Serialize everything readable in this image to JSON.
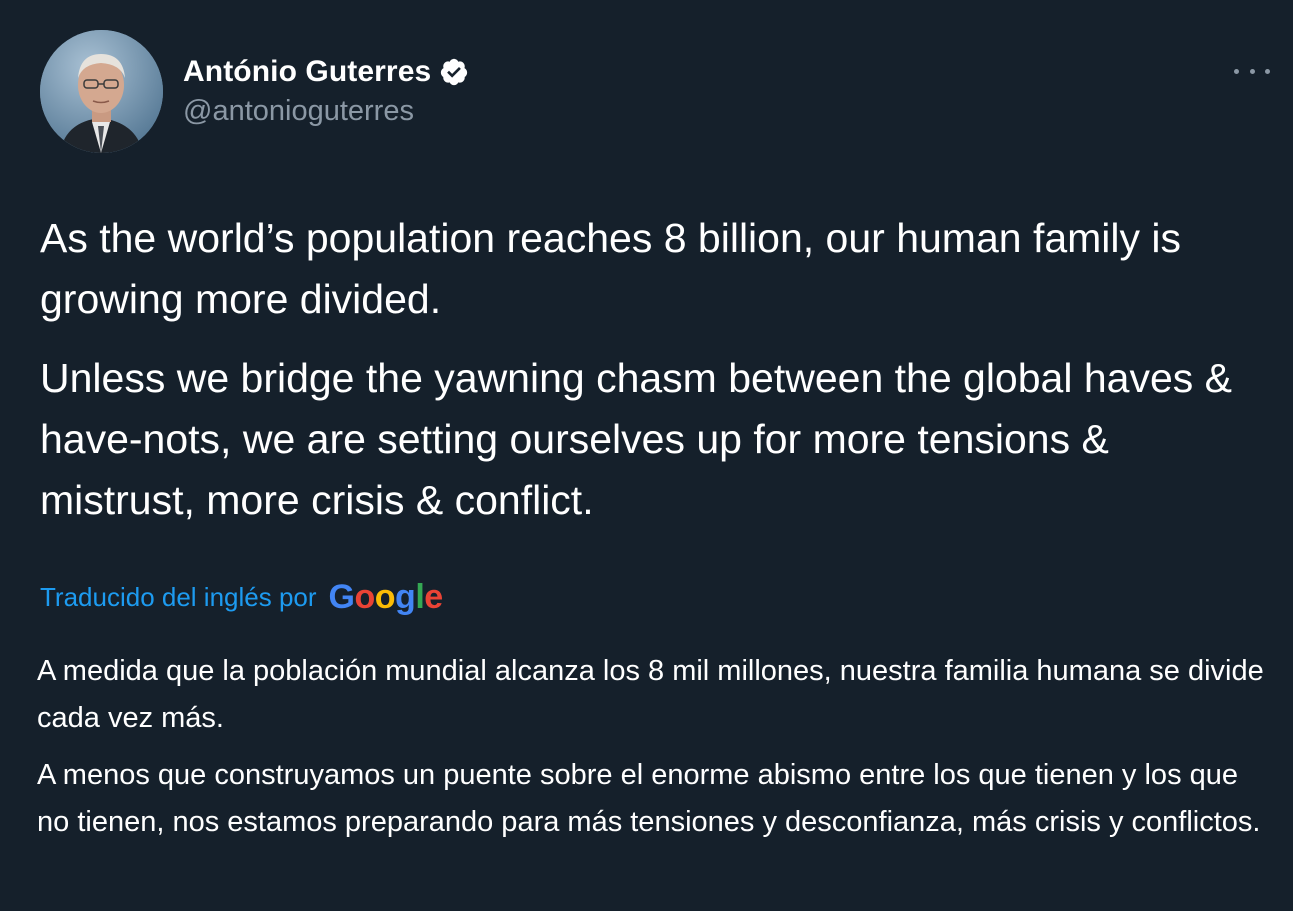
{
  "author": {
    "display_name": "António Guterres",
    "handle": "@antonioguterres",
    "avatar_icon": "avatar-portrait",
    "verified_icon": "verified-badge-icon"
  },
  "tweet": {
    "paragraphs": [
      "As the world’s population reaches 8 billion, our human family is growing more divided.",
      "Unless we bridge the yawning chasm between the global haves & have-nots, we are setting ourselves up for more tensions & mistrust, more crisis & conflict."
    ]
  },
  "translation": {
    "label": "Traducido del inglés por",
    "provider": "Google",
    "paragraphs": [
      "A medida que la población mundial alcanza los 8 mil millones, nuestra familia humana se divide cada vez más.",
      "A menos que construyamos un puente sobre el enorme abismo entre los que tienen y los que no tienen, nos estamos preparando para más tensiones y desconfianza, más crisis y conflictos."
    ]
  },
  "menu": {
    "icon": "more-options-icon"
  },
  "colors": {
    "background": "#15202b",
    "text": "#ffffff",
    "secondary_text": "#8b98a5",
    "link": "#1d9bf0",
    "verified": "#ffffff"
  }
}
